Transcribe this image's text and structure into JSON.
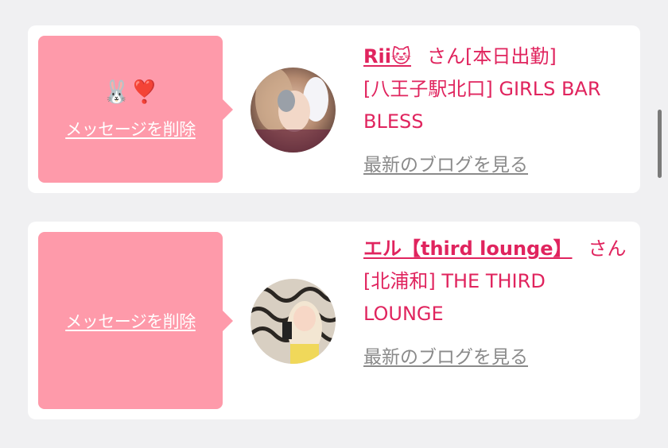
{
  "messages": [
    {
      "emoji": "🐰❣️",
      "delete_label": "メッセージを削除",
      "name": "Rii🐱",
      "honorific": "さん",
      "status": "[本日出勤]",
      "shop": "[八王子駅北口] GIRLS BAR BLESS",
      "blog_label": "最新のブログを見る"
    },
    {
      "emoji": "",
      "delete_label": "メッセージを削除",
      "name": "エル【third lounge】",
      "honorific": "さん",
      "status": "",
      "shop": "[北浦和] THE THIRD LOUNGE",
      "blog_label": "最新のブログを見る"
    }
  ],
  "colors": {
    "bubble": "#fe9aaa",
    "accent": "#e0245e",
    "muted": "#8a8a8a",
    "background": "#f0f0f2"
  }
}
